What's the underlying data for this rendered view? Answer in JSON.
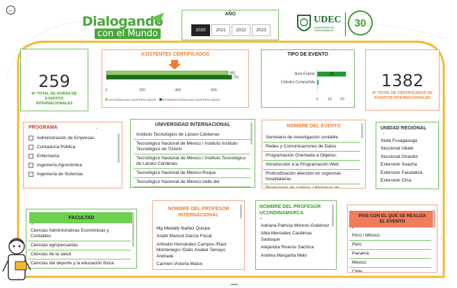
{
  "header": {
    "title_line1": "Dialogando",
    "title_line2": "con el Mundo",
    "udec_name": "UDEC",
    "udec_sub": "UNIVERSIDAD DE CUNDINAMARCA",
    "anniversary": "30"
  },
  "year_filter": {
    "title": "AÑO",
    "years": [
      "2020",
      "2021",
      "2022",
      "2023"
    ],
    "selected": "2020"
  },
  "kpi_hours": {
    "value": "259",
    "label": "N° TOTAL DE HORAS DE EVENTOS INTERNACIONALES"
  },
  "kpi_certs": {
    "value": "1382",
    "label": "N° TOTAL DE CERTIFICADOS DE EVENTOS INTERNACIONALES"
  },
  "attendees_chart": {
    "title": "ASISTENTES CERTIFICADOS",
    "legend_national": "NACIONALES CERTIFICADOS",
    "legend_international": "INTERNACIONALES CERTIFICADOS",
    "chart_data": {
      "type": "bar",
      "orientation": "horizontal",
      "series": [
        {
          "name": "NACIONALES CERTIFICADOS",
          "values": [
            681
          ],
          "color": "#8cd35f"
        },
        {
          "name": "INTERNACIONALES CERTIFICADOS",
          "values": [
            701
          ],
          "color": "#1f6e1f"
        }
      ],
      "value_labels": [
        "681",
        "701"
      ],
      "xlim": [
        0,
        700
      ],
      "xticks": [
        "0",
        "200",
        "400",
        "600"
      ]
    }
  },
  "event_type_chart": {
    "title": "TIPO DE EVENTO",
    "chart_data": {
      "type": "bar",
      "orientation": "horizontal",
      "categories": [
        "Aula Espejo",
        "Cátedra Compartida"
      ],
      "values": [
        23,
        1
      ],
      "value_labels": [
        "23",
        ""
      ],
      "xlim": [
        0,
        25
      ],
      "xticks": [
        "0",
        "10",
        "20"
      ],
      "color": "#1e9e2e"
    }
  },
  "programa": {
    "title": "PROGRAMA",
    "items": [
      "Administración de Empresas",
      "Contaduría Pública",
      "Enfermería",
      "Ingeniería Agronómica",
      "Ingeniería de Sistemas"
    ]
  },
  "universidad": {
    "title": "UNIVERSIDAD INTERNACIONAL",
    "items": [
      "Instituto Tecnológico de Lázaro Cárdenas",
      "Tecnológico Nacional de México / Instituto Instituto Tecnológico de Tizimín",
      "Tecnológico Nacional de México / Instituto Tecnológico de Lázaro Cárdenas",
      "Tecnológico Nacional de México-Roque",
      "Tecnológico Nacional de México-Valle del"
    ]
  },
  "evento": {
    "title": "NOMBRE DEL EVENTO",
    "items": [
      "Seminario de investigación contable",
      "Redes y Comunicaciones de Datos",
      "Programación Orientada a Objetos:",
      "Introducción a la Programación Web",
      "Profundización atención en urgencias hospitalarias",
      "Producción de cultivos / Sistemas de"
    ]
  },
  "unidad": {
    "title": "UNIDAD REGIONAL",
    "items": [
      "Sede Fusagasugá",
      "Seccional Ubaté",
      "Seccional Girardot",
      "Extensión Soacha",
      "Extensión Facatativá",
      "Extensión Chía"
    ]
  },
  "facultad": {
    "title": "FACULTAD",
    "items": [
      "Ciencias Administrativas Económicas y Contables",
      "Ciencias agropecuarias",
      "Ciencias de la salud",
      "Ciencias del deporte y la educación física"
    ]
  },
  "prof_int": {
    "title": "NOMBRE DEL PROFESOR INTERNACIONAL",
    "items": [
      "Mg Medally Ibañez Quispe",
      "Anahi Marisol García Fiscal",
      "Artinelio Hernández Campos /Raúl Montenegro /Dalis Anabel Tamayo Andrade",
      "Carmen Victoria Matos"
    ]
  },
  "prof_udec": {
    "title": "NOMBRE DEL PROFESOR UCUNDINAMARCA",
    "items": [
      "Adriana Patricia Moreno Gutiérrez",
      "Alba Mercedes Casilimas Sastoque",
      "Alejandra Riveros Sáchica",
      "Andrea Margarita Melo"
    ]
  },
  "pais": {
    "title": "PAIS CON EL QUE SE REALIZA EL EVENTO",
    "items": [
      "Perú / México",
      "Perú",
      "Panamá",
      "México",
      "Chile"
    ]
  },
  "colors": {
    "green": "#3f9b2b",
    "orange": "#f07c2c",
    "frame": "#f5b82e"
  }
}
